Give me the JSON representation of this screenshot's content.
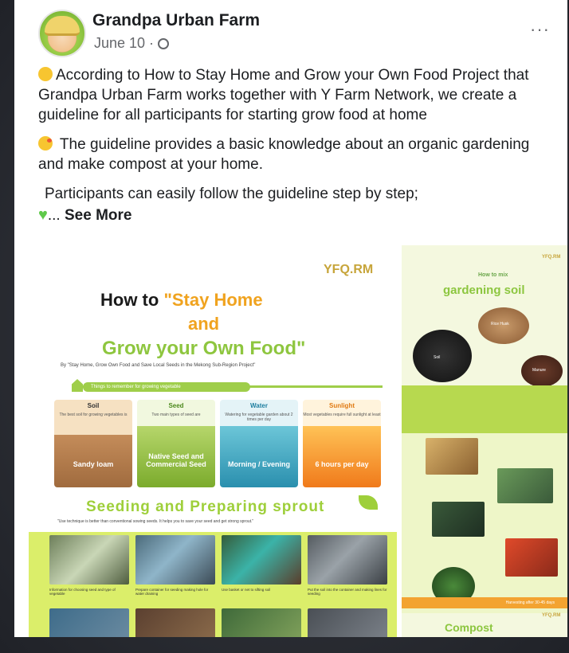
{
  "post": {
    "page_name": "Grandpa Urban Farm",
    "date": "June 10 · ",
    "privacy_icon": "globe-icon",
    "more_label": "···",
    "paragraph1": "According to How to Stay Home and Grow your Own Food Project that Grandpa Urban Farm works together with Y Farm Network, we create a guideline for all participants for starting grow food at home",
    "paragraph2": " The guideline provides a basic knowledge about an organic gardening and make compost at your home.",
    "paragraph3": "Participants can easily follow the guideline step by step;",
    "ellipsis": "... ",
    "see_more": "See More"
  },
  "poster_main": {
    "logo": "YFQ.RM",
    "title_line1_a": "How to ",
    "title_line1_b": "\"Stay Home",
    "title_line2": "and",
    "title_line3": "Grow your Own Food\"",
    "subtitle": "By \"Stay Home, Grow Own Food and Save Local Seeds in the Mekong Sub-Region Project\"",
    "remember_label": "Things to remember for growing vegetable",
    "columns": [
      {
        "title": "Soil",
        "text": "The best soil for growing vegetables is",
        "big": "Sandy loam"
      },
      {
        "title": "Seed",
        "text": "Two main types of seed are",
        "big": "Native Seed and Commercial Seed"
      },
      {
        "title": "Water",
        "text": "Watering for vegetable garden about 2 times per day",
        "big": "Morning / Evening"
      },
      {
        "title": "Sunlight",
        "text": "Most vegetables require full sunlight at least",
        "big": "6 hours per day"
      }
    ],
    "seeding_title": "Seeding and Preparing sprout",
    "seeding_sub": "\"Use technique is better than conventional sowing seeds. It helps you to save your seed and get strong sprout.\"",
    "captions": [
      "Information for choosing seed and type of vegetable",
      "Prepare container for seeding making hole for water draining",
      "Use basket or net to sifting soil",
      "Put the soil into the container and making lines for seeding"
    ]
  },
  "poster_side": {
    "logo": "YFQ.RM",
    "how_label": "How to mix",
    "title": "gardening soil",
    "labels": [
      "Rice Husk",
      "Soil",
      "Manure"
    ],
    "band": "Harvesting after 30-45 days",
    "compost": "Compost",
    "logo2": "YFQ.RM"
  },
  "colors": {
    "brand_green": "#8ec63f",
    "brand_orange": "#f0a31f",
    "text": "#1c1e21",
    "muted": "#65676b"
  }
}
